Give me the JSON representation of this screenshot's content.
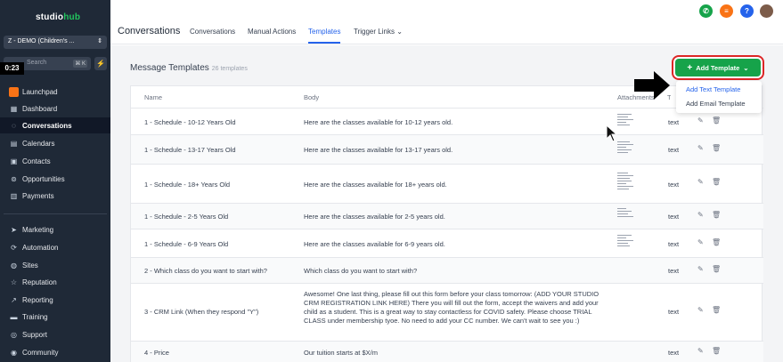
{
  "sidebar": {
    "logo": "studiohub",
    "account": "Z - DEMO (Children's ...",
    "timer": "0:23",
    "search_placeholder": "Search",
    "search_kbd": "⌘ K",
    "items": [
      {
        "label": "Launchpad",
        "icon": "rocket-icon"
      },
      {
        "label": "Dashboard",
        "icon": "dashboard-icon"
      },
      {
        "label": "Conversations",
        "icon": "chat-icon",
        "active": true
      },
      {
        "label": "Calendars",
        "icon": "calendar-icon"
      },
      {
        "label": "Contacts",
        "icon": "contacts-icon"
      },
      {
        "label": "Opportunities",
        "icon": "funnel-icon"
      },
      {
        "label": "Payments",
        "icon": "payments-icon"
      },
      {
        "label": "Marketing",
        "icon": "send-icon"
      },
      {
        "label": "Automation",
        "icon": "automation-icon"
      },
      {
        "label": "Sites",
        "icon": "globe-icon"
      },
      {
        "label": "Reputation",
        "icon": "star-icon"
      },
      {
        "label": "Reporting",
        "icon": "chart-icon"
      },
      {
        "label": "Training",
        "icon": "book-icon"
      },
      {
        "label": "Support",
        "icon": "support-icon"
      },
      {
        "label": "Community",
        "icon": "community-icon"
      }
    ]
  },
  "header": {
    "title": "Conversations",
    "tabs": [
      "Conversations",
      "Manual Actions",
      "Templates",
      "Trigger Links"
    ],
    "active_tab": "Templates"
  },
  "main": {
    "title": "Message Templates",
    "count": "26 templates",
    "add_button": "Add Template",
    "dropdown": [
      "Add Text Template",
      "Add Email Template"
    ],
    "columns": [
      "Name",
      "Body",
      "Attachments",
      "Type"
    ],
    "rows": [
      {
        "name": "1 - Schedule - 10-12 Years Old",
        "body": "Here are the classes available for 10-12 years old.",
        "type": "text"
      },
      {
        "name": "1 - Schedule - 13-17 Years Old",
        "body": "Here are the classes available for 13-17 years old.",
        "type": "text"
      },
      {
        "name": "1 - Schedule - 18+ Years Old",
        "body": "Here are the classes available for 18+ years old.",
        "type": "text"
      },
      {
        "name": "1 - Schedule - 2-5 Years Old",
        "body": "Here are the classes available for 2-5 years old.",
        "type": "text"
      },
      {
        "name": "1 - Schedule - 6-9 Years Old",
        "body": "Here are the classes available for 6-9 years old.",
        "type": "text"
      },
      {
        "name": "2 - Which class do you want to start with?",
        "body": "Which class do you want to start with?",
        "type": "text"
      },
      {
        "name": "3 - CRM Link (When they respond \"Y\")",
        "body": "Awesome! One last thing, please fill out this form before your class tomorrow: (ADD YOUR STUDIO CRM REGISTRATION LINK HERE) There you will fill out the form, accept the waivers and add your child as a student. This is a great way to stay contactless for COVID safety. Please choose TRIAL CLASS under membership tyoe. No need to add your CC number. We can't wait to see you :)",
        "type": "text"
      },
      {
        "name": "4 - Price",
        "body": "Our tuition starts at $X/m",
        "type": "text"
      }
    ]
  },
  "colors": {
    "sidebar_bg": "#1f2937",
    "accent_blue": "#2563eb",
    "button_green": "#16a34a",
    "highlight_red": "#dc2626"
  }
}
